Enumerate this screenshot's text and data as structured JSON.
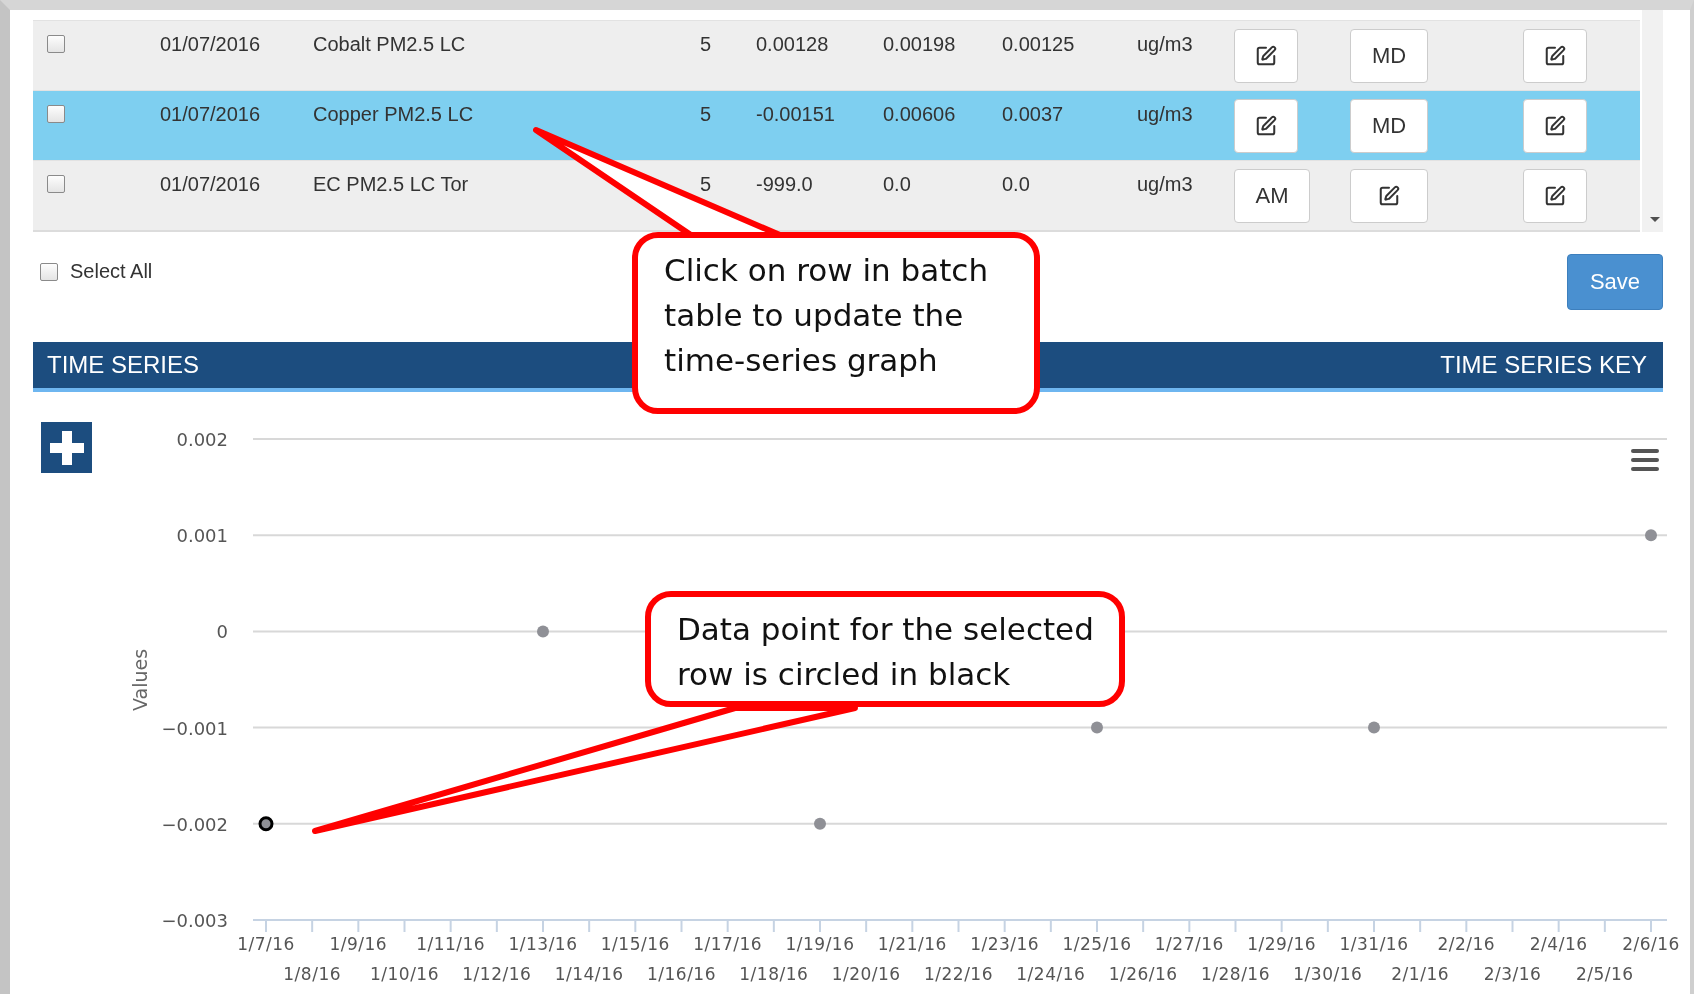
{
  "table": {
    "rows": [
      {
        "selected": false,
        "checked": false,
        "date": "01/07/2016",
        "parameter": "Cobalt PM2.5 LC",
        "column_4": "5",
        "column_5": "0.00128",
        "column_6": "0.00198",
        "column_7": "0.00125",
        "unit": "ug/m3",
        "actions": [
          {
            "kind": "edit"
          },
          {
            "kind": "text",
            "label": "MD"
          },
          {
            "kind": "edit"
          }
        ]
      },
      {
        "selected": true,
        "checked": false,
        "date": "01/07/2016",
        "parameter": "Copper PM2.5 LC",
        "column_4": "5",
        "column_5": "-0.00151",
        "column_6": "0.00606",
        "column_7": "0.0037",
        "unit": "ug/m3",
        "actions": [
          {
            "kind": "edit"
          },
          {
            "kind": "text",
            "label": "MD"
          },
          {
            "kind": "edit"
          }
        ]
      },
      {
        "selected": false,
        "checked": false,
        "date": "01/07/2016",
        "parameter": "EC PM2.5 LC Tor",
        "column_4": "5",
        "column_5": "-999.0",
        "column_6": "0.0",
        "column_7": "0.0",
        "unit": "ug/m3",
        "actions": [
          {
            "kind": "text",
            "label": "AM"
          },
          {
            "kind": "edit"
          },
          {
            "kind": "edit"
          }
        ]
      }
    ]
  },
  "select_all": {
    "label": "Select All",
    "checked": false
  },
  "save_button": "Save",
  "panel": {
    "title": "TIME SERIES",
    "key_label": "TIME SERIES KEY"
  },
  "chart": {
    "points": [
      {
        "selected": true
      },
      {
        "selected": false
      },
      {
        "selected": false
      },
      {
        "selected": false
      },
      {
        "selected": false
      },
      {
        "selected": false
      }
    ],
    "chart_data": {
      "type": "scatter",
      "ylabel": "Values",
      "grid": true,
      "categories": [
        "1/7/16",
        "1/8/16",
        "1/9/16",
        "1/10/16",
        "1/11/16",
        "1/12/16",
        "1/13/16",
        "1/14/16",
        "1/15/16",
        "1/16/16",
        "1/17/16",
        "1/18/16",
        "1/19/16",
        "1/20/16",
        "1/21/16",
        "1/22/16",
        "1/23/16",
        "1/24/16",
        "1/25/16",
        "1/26/16",
        "1/27/16",
        "1/28/16",
        "1/29/16",
        "1/30/16",
        "1/31/16",
        "2/1/16",
        "2/2/16",
        "2/3/16",
        "2/4/16",
        "2/5/16",
        "2/6/16"
      ],
      "series": [
        {
          "color": "#8f9096",
          "values": [
            -0.002,
            null,
            null,
            null,
            null,
            null,
            0,
            null,
            null,
            null,
            null,
            null,
            -0.002,
            null,
            null,
            null,
            null,
            null,
            -0.001,
            null,
            null,
            null,
            null,
            null,
            -0.001,
            null,
            null,
            null,
            null,
            null,
            0.001
          ]
        }
      ],
      "ylim": [
        -0.003,
        0.002
      ],
      "yticks": [
        {
          "value": 0.002,
          "label": "0.002"
        },
        {
          "value": 0.001,
          "label": "0.001"
        },
        {
          "value": 0,
          "label": "0"
        },
        {
          "value": -0.001,
          "label": "−0.001"
        },
        {
          "value": -0.002,
          "label": "−0.002"
        },
        {
          "value": -0.003,
          "label": "−0.003"
        }
      ]
    }
  },
  "callouts": [
    {
      "lines": [
        "Click on row in batch",
        "table to update the",
        "time-series graph"
      ]
    },
    {
      "lines": [
        "Data point for the selected",
        "row is circled in black"
      ]
    }
  ]
}
